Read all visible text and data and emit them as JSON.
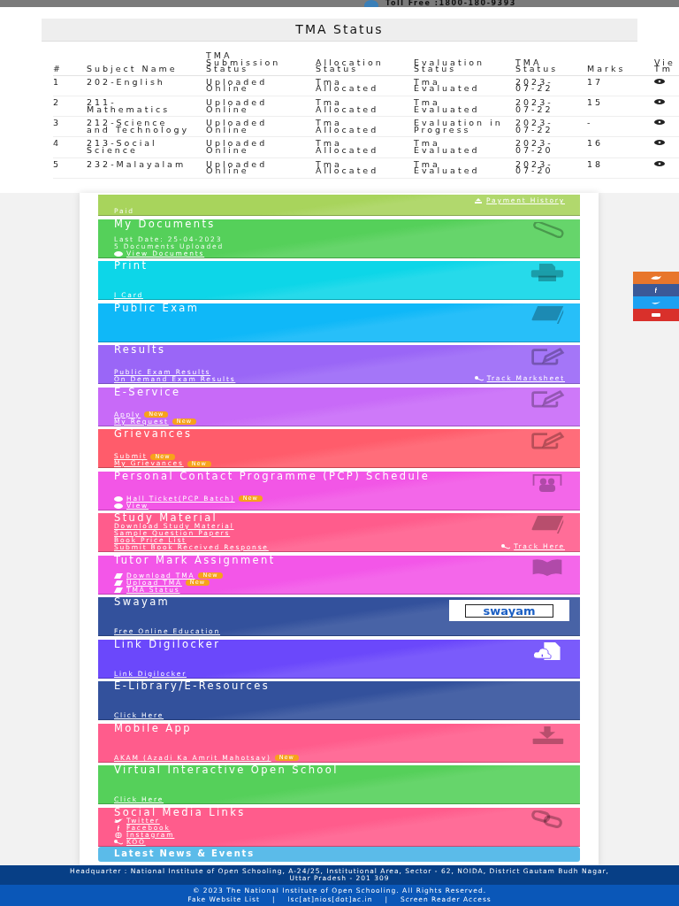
{
  "top_bar": {
    "toll_free": "Toll Free :1800-180-9393"
  },
  "modal": {
    "title": "TMA Status",
    "columns": [
      "#",
      "Subject Name",
      "TMA Submission Status",
      "Allocation Status",
      "Evaluation Status",
      "TMA Status",
      "Marks",
      "Vie Tm"
    ],
    "rows": [
      {
        "no": "1",
        "subject": "202-English",
        "submission": "Uploaded Online",
        "allocation": "Tma Allocated",
        "evaluation": "Tma Evaluated",
        "tma_status": "2023-07-22",
        "marks": "17"
      },
      {
        "no": "2",
        "subject": "211-Mathematics",
        "submission": "Uploaded Online",
        "allocation": "Tma Allocated",
        "evaluation": "Tma Evaluated",
        "tma_status": "2023-07-22",
        "marks": "15"
      },
      {
        "no": "3",
        "subject": "212-Science and Technology",
        "submission": "Uploaded Online",
        "allocation": "Tma Allocated",
        "evaluation": "Evaluation in Progress",
        "tma_status": "2023-07-22",
        "marks": "-"
      },
      {
        "no": "4",
        "subject": "213-Social Science",
        "submission": "Uploaded Online",
        "allocation": "Tma Allocated",
        "evaluation": "Tma Evaluated",
        "tma_status": "2023-07-20",
        "marks": "16"
      },
      {
        "no": "5",
        "subject": "232-Malayalam",
        "submission": "Uploaded Online",
        "allocation": "Tma Allocated",
        "evaluation": "Tma Evaluated",
        "tma_status": "2023-07-20",
        "marks": "18"
      }
    ]
  },
  "cards": [
    {
      "color": "#a8d45c",
      "kind": "plain",
      "lines": [
        {
          "text": "Paid",
          "link": false,
          "kind": "plain"
        }
      ],
      "right_link": {
        "text": "Payment History",
        "kind": "upload"
      }
    },
    {
      "title": "My Documents",
      "color": "#55d05a",
      "kind": "paperclip",
      "lines": [
        {
          "text": "Last Date: 25-04-2023",
          "link": false,
          "kind": "plain"
        },
        {
          "text": "5 Documents Uploaded",
          "link": false,
          "kind": "plain"
        },
        {
          "text": "View Documents",
          "link": true,
          "kind": "eye"
        }
      ]
    },
    {
      "title": "Print",
      "color": "#0dd6e8",
      "kind": "printer",
      "lines": [
        {
          "text": "I Card",
          "link": true,
          "kind": "plain"
        }
      ]
    },
    {
      "title": "Public Exam",
      "color": "#0fb8f8",
      "kind": "book"
    },
    {
      "title": "Results",
      "color": "#9a66f7",
      "kind": "edit",
      "lines": [
        {
          "text": "Public Exam Results",
          "link": true,
          "kind": "plain"
        },
        {
          "text": "On Demand Exam Results",
          "link": true,
          "kind": "plain"
        }
      ],
      "right_link": {
        "text": "Track Marksheet",
        "kind": "key"
      }
    },
    {
      "title": "E-Service",
      "color": "#c86af8",
      "kind": "edit",
      "lines": [
        {
          "text": "Apply",
          "link": true,
          "kind": "plain",
          "badge": "New"
        },
        {
          "text": "My Request",
          "link": true,
          "kind": "plain",
          "badge": "New"
        }
      ]
    },
    {
      "title": "Grievances",
      "color": "#ff5c6b",
      "kind": "edit",
      "lines": [
        {
          "text": "Submit",
          "link": true,
          "kind": "plain",
          "badge": "New"
        },
        {
          "text": "My Grievances",
          "link": true,
          "kind": "plain",
          "badge": "New"
        }
      ]
    },
    {
      "title": "Personal Contact Programme (PCP) Schedule",
      "color": "#f256e6",
      "kind": "group",
      "lines": [
        {
          "text": "Hall Ticket(PCP Batch)",
          "link": true,
          "kind": "eye",
          "badge": "New"
        },
        {
          "text": "View",
          "link": true,
          "kind": "eye"
        }
      ]
    },
    {
      "title": "Study Material",
      "color": "#ff5c8c",
      "kind": "book",
      "lines": [
        {
          "text": "Download Study Material",
          "link": true,
          "kind": "plain"
        },
        {
          "text": "Sample Question Papers",
          "link": true,
          "kind": "plain"
        },
        {
          "text": "Book Price List",
          "link": true,
          "kind": "plain"
        },
        {
          "text": "Submit Book Received Response",
          "link": true,
          "kind": "plain"
        }
      ],
      "right_link": {
        "text": "Track Here",
        "kind": "key"
      }
    },
    {
      "title": "Tutor Mark Assignment",
      "color": "#f356e8",
      "kind": "open-book",
      "lines": [
        {
          "text": "Download TMA",
          "link": true,
          "kind": "file",
          "badge": "New"
        },
        {
          "text": "Upload TMA",
          "link": true,
          "kind": "file",
          "badge": "New"
        },
        {
          "text": "TMA Status",
          "link": true,
          "kind": "file"
        }
      ]
    },
    {
      "title": "Swayam",
      "color": "#33519c",
      "kind": "logo",
      "logo_text": "swayam",
      "lines": [
        {
          "text": "Free Online Education",
          "link": true,
          "kind": "plain"
        }
      ]
    },
    {
      "title": "Link Digilocker",
      "color": "#6b48fb",
      "kind": "cloud-file",
      "lines": [
        {
          "text": "Link Digilocker",
          "link": true,
          "kind": "plain"
        }
      ]
    },
    {
      "title": "E-Library/E-Resources",
      "color": "#33519c",
      "kind": "plain",
      "lines": [
        {
          "text": "Click Here",
          "link": true,
          "kind": "plain"
        }
      ]
    },
    {
      "title": "Mobile App",
      "color": "#ff5c8c",
      "kind": "download",
      "lines": [
        {
          "text": "AKAM (Azadi Ka Amrit Mahotsav)",
          "link": true,
          "kind": "plain",
          "badge": "New"
        }
      ]
    },
    {
      "title": "Virtual Interactive Open School",
      "color": "#55d05a",
      "kind": "plain",
      "lines": [
        {
          "text": "Click Here",
          "link": true,
          "kind": "plain"
        }
      ]
    },
    {
      "title": "Social Media Links",
      "color": "#ff5c8c",
      "kind": "chain",
      "lines": [
        {
          "text": "Twitter",
          "link": true,
          "kind": "bird"
        },
        {
          "text": "Facebook",
          "link": true,
          "kind": "letter-f"
        },
        {
          "text": "Instagram",
          "link": true,
          "kind": "camera"
        },
        {
          "text": "KOO",
          "link": true,
          "kind": "key"
        }
      ]
    }
  ],
  "news_header": {
    "title": "Latest News & Events"
  },
  "side_social": [
    {
      "color": "#e8762b",
      "kind": "koo"
    },
    {
      "color": "#3b5998",
      "kind": "letter-f"
    },
    {
      "color": "#1da1f2",
      "kind": "bird"
    },
    {
      "color": "#d9302b",
      "kind": "play"
    }
  ],
  "footer": {
    "address": "Headquarter : National Institute of Open Schooling, A-24/25, Institutional Area, Sector - 62, NOIDA, District Gautam Budh Nagar, Uttar Pradesh - 201 309",
    "copyright": "© 2023 The National Institute of Open Schooling. All Rights Reserved.",
    "separator": "|",
    "links": [
      "Fake Website List",
      "lsc[at]nios[dot]ac.in",
      "Screen Reader Access"
    ]
  }
}
